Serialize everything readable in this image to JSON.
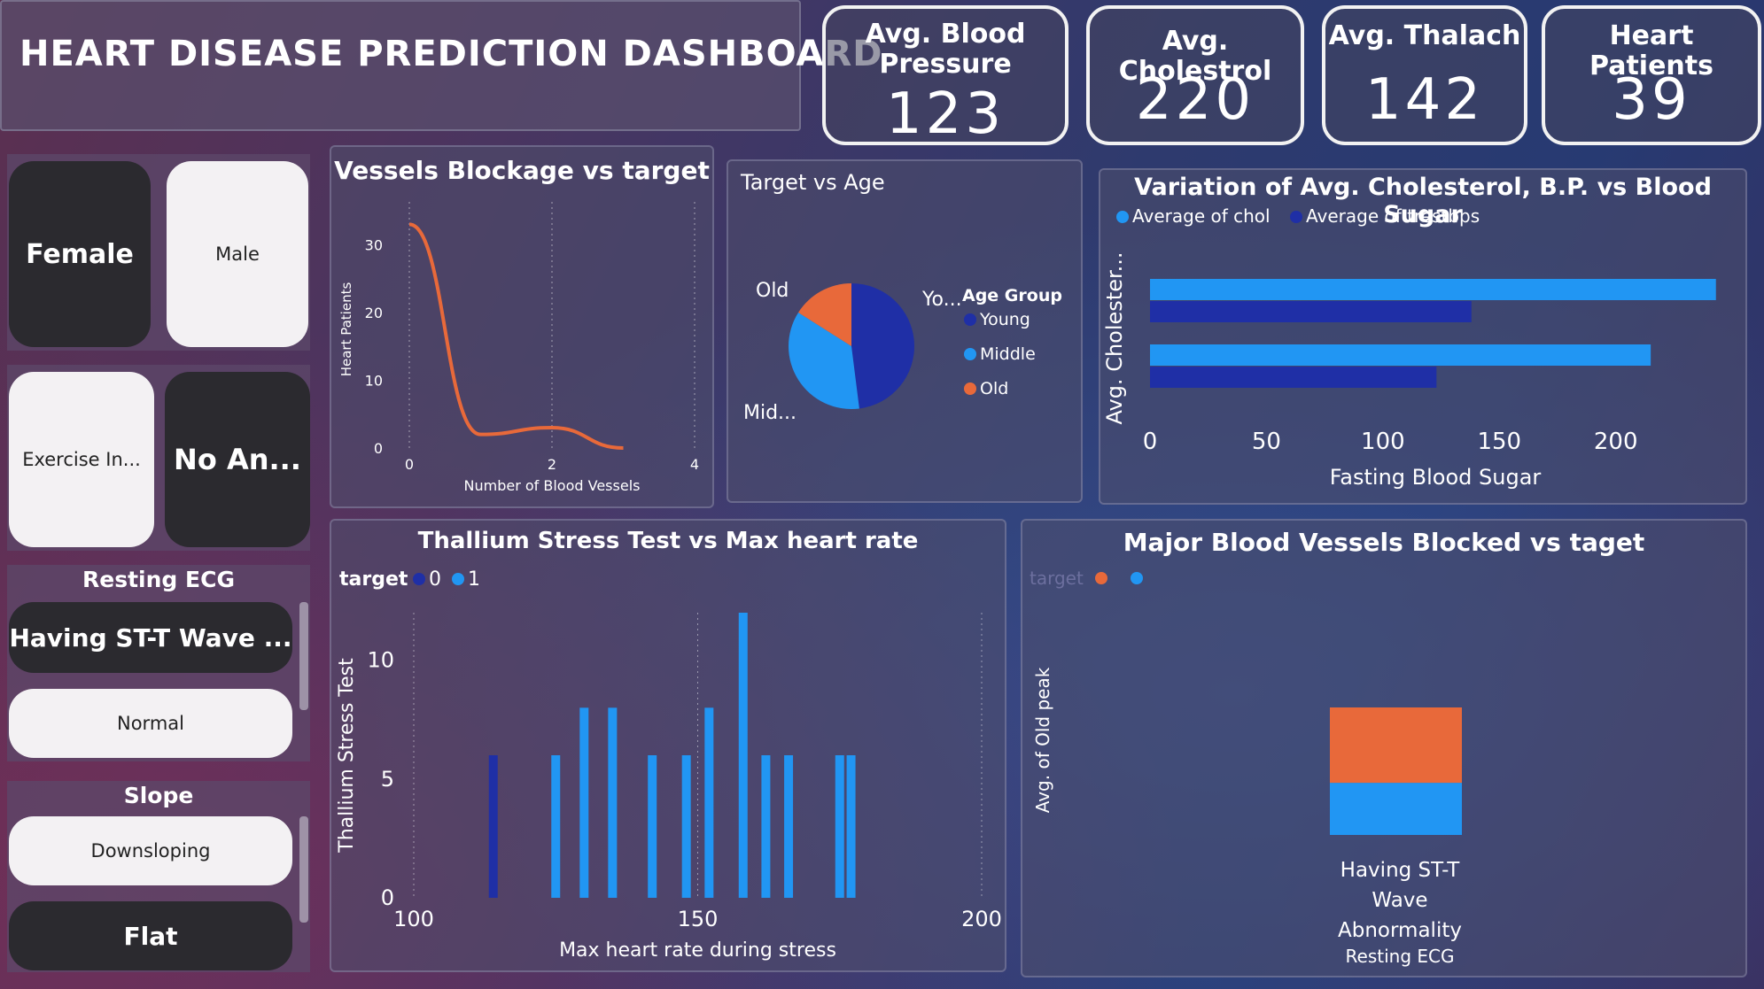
{
  "header": {
    "title": "HEART DISEASE PREDICTION DASHBOARD"
  },
  "kpis": [
    {
      "label": "Avg. Blood Pressure",
      "value": "123"
    },
    {
      "label": "Avg. Cholestrol",
      "value": "220"
    },
    {
      "label": "Avg. Thalach",
      "value": "142"
    },
    {
      "label": "Heart Patients",
      "value": "39"
    }
  ],
  "slicers": {
    "sex": [
      "Female",
      "Male"
    ],
    "exercise": [
      "Exercise In...",
      "No An..."
    ],
    "resting_ecg": {
      "title": "Resting ECG",
      "items": [
        "Having ST-T Wave ...",
        "Normal"
      ]
    },
    "slope": {
      "title": "Slope",
      "items": [
        "Downsloping",
        "Flat"
      ]
    }
  },
  "colors": {
    "orange": "#e8693a",
    "blue": "#2196f3",
    "navy": "#1f2fa6",
    "kpi_border": "#f2f2f2"
  },
  "chart_data": [
    {
      "id": "vessels",
      "type": "line",
      "title": "Vessels Blockage vs target",
      "xlabel": "Number of Blood Vessels",
      "ylabel": "Heart Patients",
      "x": [
        0,
        1,
        2,
        3
      ],
      "values": [
        33,
        2,
        3,
        0
      ],
      "xticks": [
        "0",
        "2",
        "4"
      ],
      "yticks": [
        "0",
        "10",
        "20",
        "30"
      ],
      "xlim": [
        0,
        4
      ],
      "ylim": [
        0,
        35
      ],
      "grid": true
    },
    {
      "id": "pie",
      "type": "pie",
      "title": "Target vs Age",
      "legend_title": "Age Group",
      "categories": [
        "Young",
        "Middle",
        "Old"
      ],
      "values": [
        48,
        36,
        16
      ],
      "slice_labels": [
        "Yo...",
        "Mid...",
        "Old"
      ]
    },
    {
      "id": "chol",
      "type": "bar",
      "orientation": "horizontal",
      "title": "Variation of Avg. Cholesterol, B.P. vs Blood Sugar",
      "xlabel": "Fasting Blood Sugar",
      "ylabel": "Avg. Cholester...",
      "categories": [
        "",
        ""
      ],
      "series": [
        {
          "name": "Average of chol",
          "values": [
            243,
            215
          ]
        },
        {
          "name": "Average of trestbps",
          "values": [
            138,
            123
          ]
        }
      ],
      "xticks": [
        "0",
        "50",
        "100",
        "150",
        "200"
      ],
      "xlim": [
        0,
        245
      ]
    },
    {
      "id": "thal",
      "type": "bar",
      "title": "Thallium Stress Test vs Max heart rate",
      "xlabel": "Max heart rate during stress",
      "ylabel": "Thallium Stress Test",
      "legend_title": "target",
      "series": [
        {
          "name": "0",
          "x": [
            114
          ],
          "values": [
            6
          ]
        },
        {
          "name": "1",
          "x": [
            125,
            130,
            135,
            142,
            148,
            152,
            158,
            162,
            166,
            175,
            177
          ],
          "values": [
            6,
            8,
            8,
            6,
            6,
            8,
            12,
            6,
            6,
            6,
            6
          ]
        }
      ],
      "xticks": [
        "100",
        "150",
        "200"
      ],
      "yticks": [
        "0",
        "5",
        "10"
      ],
      "xlim": [
        100,
        200
      ],
      "ylim": [
        0,
        12
      ]
    },
    {
      "id": "major",
      "type": "bar",
      "stacked": true,
      "title": "Major Blood Vessels Blocked vs taget",
      "xlabel": "Resting ECG",
      "ylabel": "Avg. of Old peak",
      "legend_title": "target",
      "categories": [
        "Having ST-T Wave Abnormality"
      ],
      "series": [
        {
          "name": "",
          "values": [
            0.9
          ]
        },
        {
          "name": "",
          "values": [
            1.3
          ]
        }
      ]
    }
  ]
}
